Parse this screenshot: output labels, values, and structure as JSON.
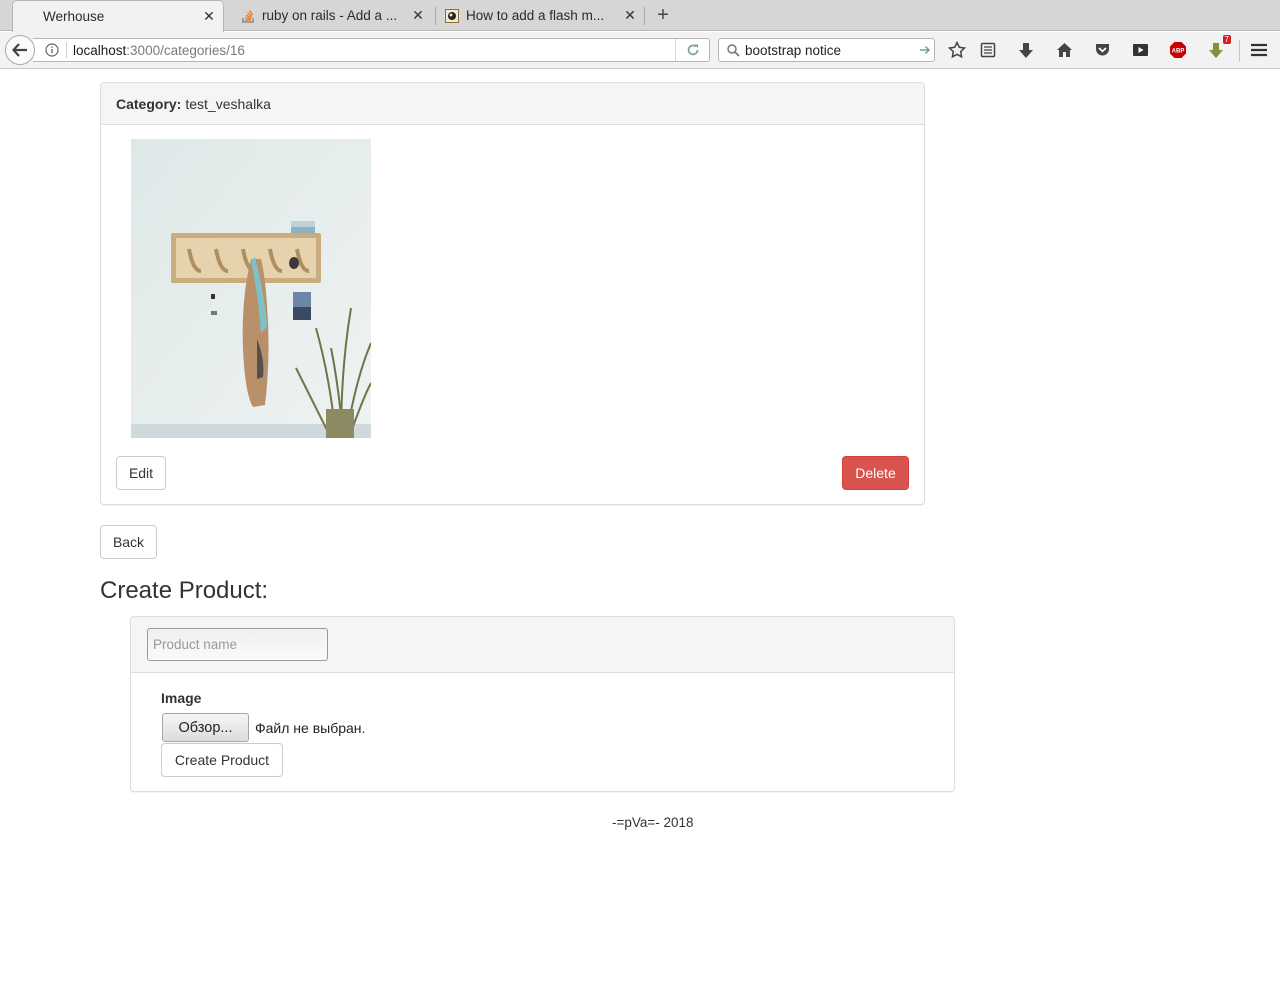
{
  "browser": {
    "tabs": [
      {
        "title": "Werhouse",
        "favicon": "blank"
      },
      {
        "title": "ruby on rails - Add a ...",
        "favicon": "stackoverflow-icon"
      },
      {
        "title": "How to add a flash m...",
        "favicon": "site-icon"
      }
    ],
    "new_tab_label": "+",
    "url_host": "localhost",
    "url_path": ":3000/categories/16",
    "search_value": "bootstrap notice",
    "addon_badge": "7",
    "abp_label": "ABP"
  },
  "category": {
    "label": "Category:",
    "name": "test_veshalka",
    "image_alt": "coat rack photo",
    "edit_label": "Edit",
    "delete_label": "Delete"
  },
  "back_label": "Back",
  "create_product": {
    "heading": "Create Product:",
    "name_placeholder": "Product name",
    "image_label": "Image",
    "browse_label": "Обзор...",
    "no_file_text": "Файл не выбран.",
    "submit_label": "Create Product"
  },
  "footer": "-=pVa=- 2018",
  "colors": {
    "danger": "#d9534f",
    "panel_head": "#f5f5f5",
    "border": "#dddddd"
  }
}
